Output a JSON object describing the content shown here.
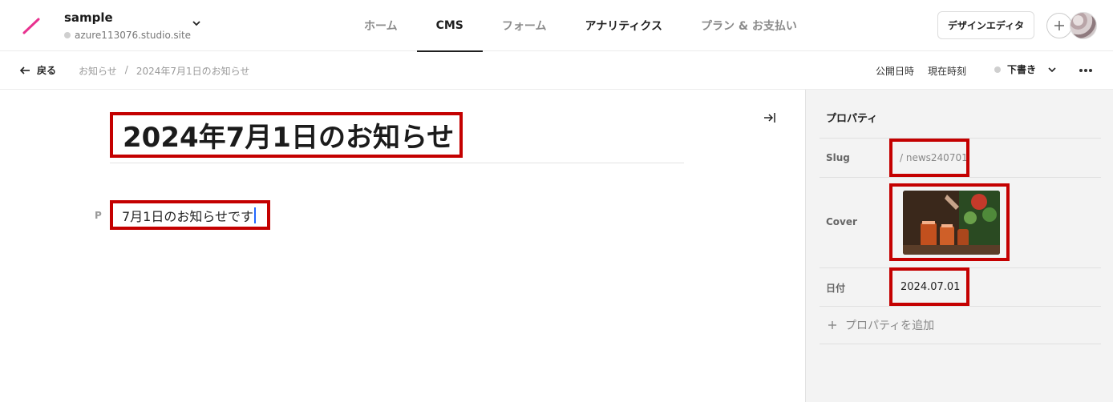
{
  "header": {
    "site_name": "sample",
    "site_url": "azure113076.studio.site",
    "nav": [
      {
        "label": "ホーム"
      },
      {
        "label": "CMS"
      },
      {
        "label": "フォーム"
      },
      {
        "label": "アナリティクス"
      },
      {
        "label": "プラン & お支払い"
      }
    ],
    "active_nav": "CMS",
    "design_editor_label": "デザインエディタ"
  },
  "subbar": {
    "back_label": "戻る",
    "breadcrumb": [
      "お知らせ",
      "/",
      "2024年7月1日のお知らせ"
    ],
    "publish_label": "公開日時",
    "publish_value": "現在時刻",
    "status_label": "下書き"
  },
  "editor": {
    "title": "2024年7月1日のお知らせ",
    "paragraph_marker": "P",
    "paragraph_text": "7月1日のお知らせです"
  },
  "properties": {
    "title": "プロパティ",
    "slug_label": "Slug",
    "slug_value": "/ news240701",
    "cover_label": "Cover",
    "date_label": "日付",
    "date_value": "2024.07.01",
    "add_label": "プロパティを追加"
  },
  "colors": {
    "accent_logo": "#e8318f",
    "highlight_border": "#c40000",
    "caret": "#2468ff"
  }
}
